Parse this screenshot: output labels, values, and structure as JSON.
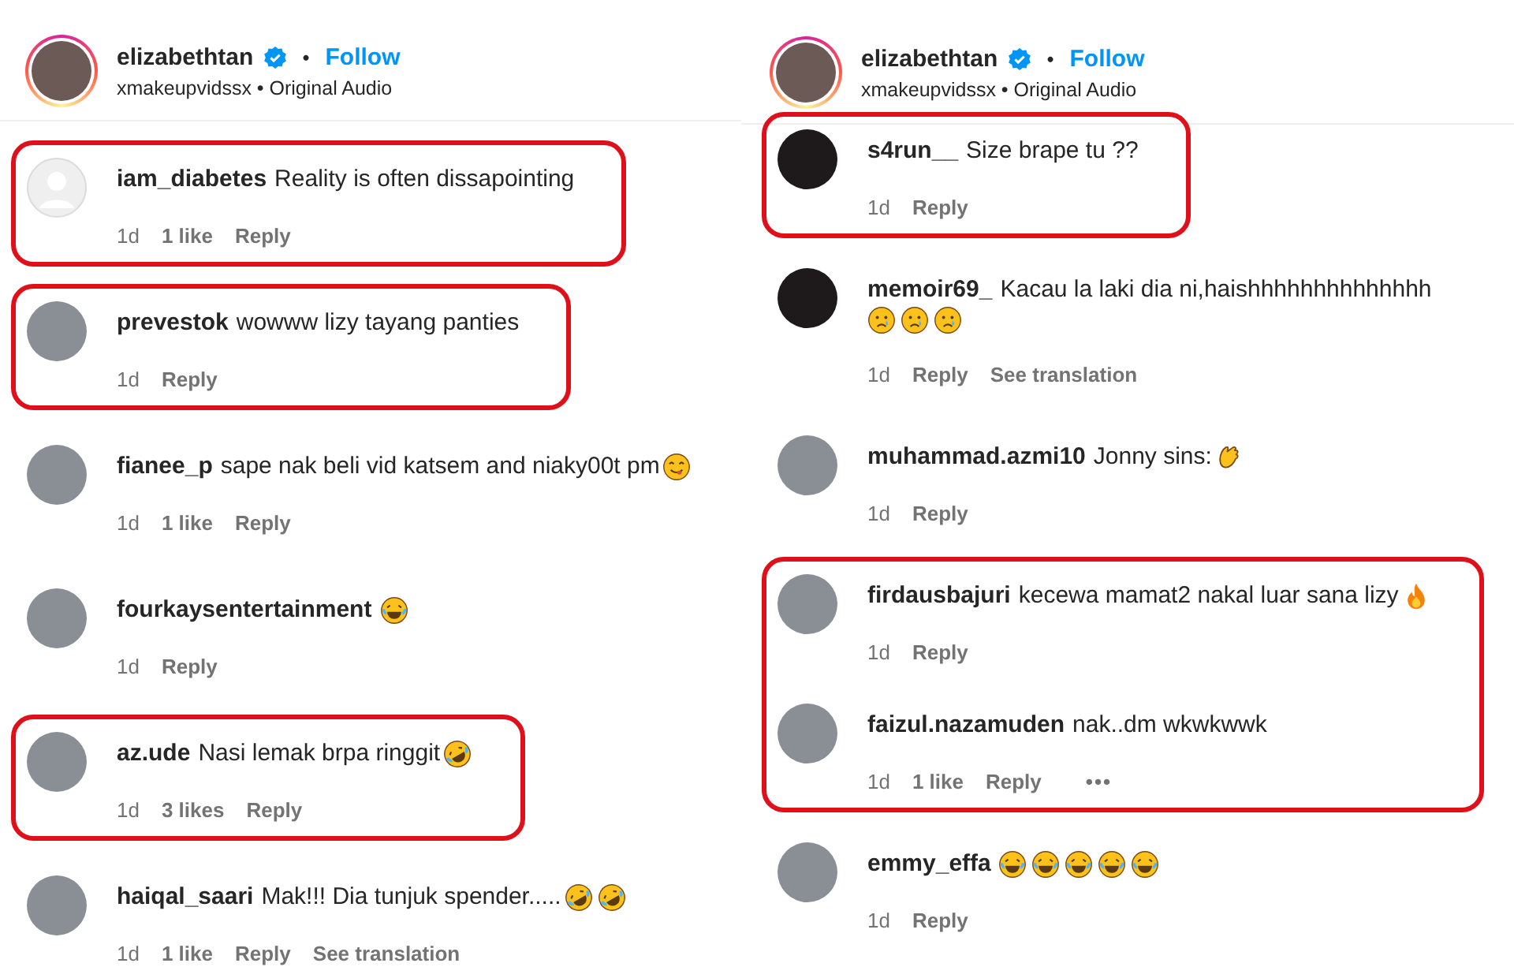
{
  "panels": [
    {
      "header": {
        "username": "elizabethtan",
        "verified": true,
        "separator": "•",
        "follow": "Follow",
        "subtitle": "xmakeupvidssx • Original Audio"
      },
      "groups": [
        {
          "highlighted": true,
          "comments": [
            {
              "default_avatar": true,
              "username": "iam_diabetes",
              "text": "Reality is often dissapointing",
              "time": "1d",
              "likes": "1 like",
              "reply": "Reply"
            }
          ]
        },
        {
          "highlighted": true,
          "comments": [
            {
              "default_avatar": false,
              "username": "prevestok",
              "text": "wowww lizy tayang panties",
              "time": "1d",
              "reply": "Reply"
            }
          ]
        },
        {
          "highlighted": false,
          "comments": [
            {
              "default_avatar": false,
              "username": "fianee_p",
              "text": "sape nak beli vid katsem and niaky00t pm",
              "emojis": [
                {
                  "kind": "yum"
                }
              ],
              "time": "1d",
              "likes": "1 like",
              "reply": "Reply"
            }
          ]
        },
        {
          "highlighted": false,
          "comments": [
            {
              "default_avatar": false,
              "username": "fourkaysentertainment",
              "emojis": [
                {
                  "kind": "joy"
                }
              ],
              "time": "1d",
              "reply": "Reply"
            }
          ]
        },
        {
          "highlighted": true,
          "comments": [
            {
              "default_avatar": false,
              "username": "az.ude",
              "text": "Nasi lemak brpa ringgit",
              "emojis": [
                {
                  "kind": "rofl"
                }
              ],
              "time": "1d",
              "likes": "3 likes",
              "reply": "Reply"
            }
          ]
        },
        {
          "highlighted": false,
          "comments": [
            {
              "default_avatar": false,
              "username": "haiqal_saari",
              "text": "Mak!!! Dia tunjuk spender.....",
              "emojis": [
                {
                  "kind": "rofl"
                },
                {
                  "kind": "rofl"
                }
              ],
              "time": "1d",
              "likes": "1 like",
              "reply": "Reply",
              "translation": "See translation"
            }
          ]
        }
      ]
    },
    {
      "header": {
        "username": "elizabethtan",
        "verified": true,
        "separator": "•",
        "follow": "Follow",
        "subtitle": "xmakeupvidssx • Original Audio"
      },
      "groups": [
        {
          "highlighted": true,
          "comments": [
            {
              "default_avatar": false,
              "username": "s4run__",
              "text": "Size brape tu ??",
              "time": "1d",
              "reply": "Reply"
            }
          ]
        },
        {
          "highlighted": false,
          "comments": [
            {
              "default_avatar": false,
              "username": "memoir69_",
              "text": "Kacau la laki dia ni,haishhhhhhhhhhhhhh",
              "emojis": [
                {
                  "kind": "cry"
                },
                {
                  "kind": "cry"
                },
                {
                  "kind": "cry"
                }
              ],
              "time": "1d",
              "reply": "Reply",
              "translation": "See translation"
            }
          ]
        },
        {
          "highlighted": false,
          "comments": [
            {
              "default_avatar": false,
              "username": "muhammad.azmi10",
              "text": "Jonny sins:",
              "emojis": [
                {
                  "kind": "clap"
                }
              ],
              "time": "1d",
              "reply": "Reply"
            }
          ]
        },
        {
          "highlighted": true,
          "comments": [
            {
              "default_avatar": false,
              "username": "firdausbajuri",
              "text": "kecewa mamat2 nakal luar sana lizy",
              "emojis": [
                {
                  "kind": "fire"
                }
              ],
              "time": "1d",
              "reply": "Reply"
            },
            {
              "default_avatar": false,
              "username": "faizul.nazamuden",
              "text": "nak..dm wkwkwwk",
              "time": "1d",
              "likes": "1 like",
              "reply": "Reply",
              "more": "•••"
            }
          ]
        },
        {
          "highlighted": false,
          "comments": [
            {
              "default_avatar": false,
              "username": "emmy_effa",
              "emojis": [
                {
                  "kind": "joy"
                },
                {
                  "kind": "joy"
                },
                {
                  "kind": "joy"
                },
                {
                  "kind": "joy"
                },
                {
                  "kind": "joy"
                }
              ],
              "time": "1d",
              "reply": "Reply"
            }
          ]
        }
      ]
    }
  ]
}
